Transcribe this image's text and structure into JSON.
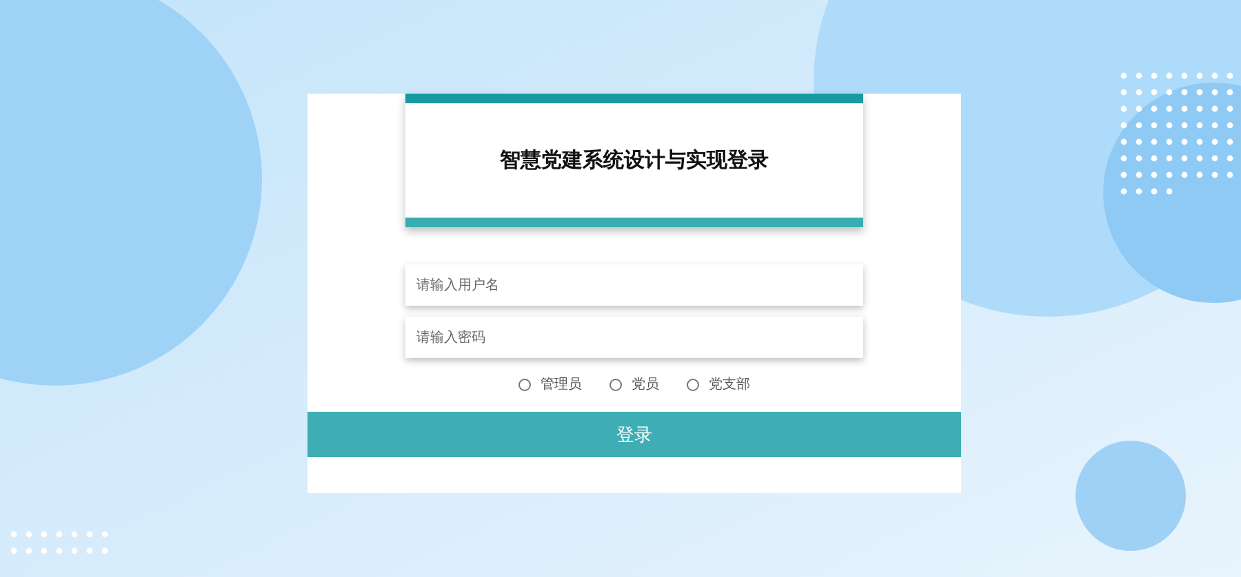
{
  "title": "智慧党建系统设计与实现登录",
  "fields": [
    {
      "placeholder": "请输入用户名"
    },
    {
      "placeholder": "请输入密码"
    }
  ],
  "roles": [
    {
      "label": "管理员",
      "selected": false
    },
    {
      "label": "党员",
      "selected": false
    },
    {
      "label": "党支部",
      "selected": false
    }
  ],
  "login_button": "登录"
}
